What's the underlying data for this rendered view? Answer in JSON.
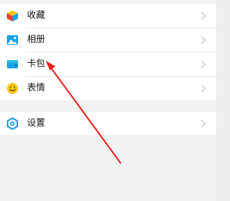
{
  "menu": {
    "items": [
      {
        "label": "收藏",
        "icon": "favorites-cube-icon"
      },
      {
        "label": "相册",
        "icon": "album-photo-icon"
      },
      {
        "label": "卡包",
        "icon": "card-wallet-icon"
      },
      {
        "label": "表情",
        "icon": "emoji-smile-icon"
      }
    ],
    "settings": {
      "label": "设置",
      "icon": "settings-gear-icon"
    }
  },
  "annotation": {
    "arrow_color": "#e8231f",
    "points_to": "卡包"
  },
  "colors": {
    "background": "#f2f2f2",
    "row_background": "#ffffff",
    "divider": "#e6e6e6",
    "chevron": "#c7c7cc",
    "accent_blue": "#1aa0e8",
    "accent_yellow": "#f5c518"
  }
}
